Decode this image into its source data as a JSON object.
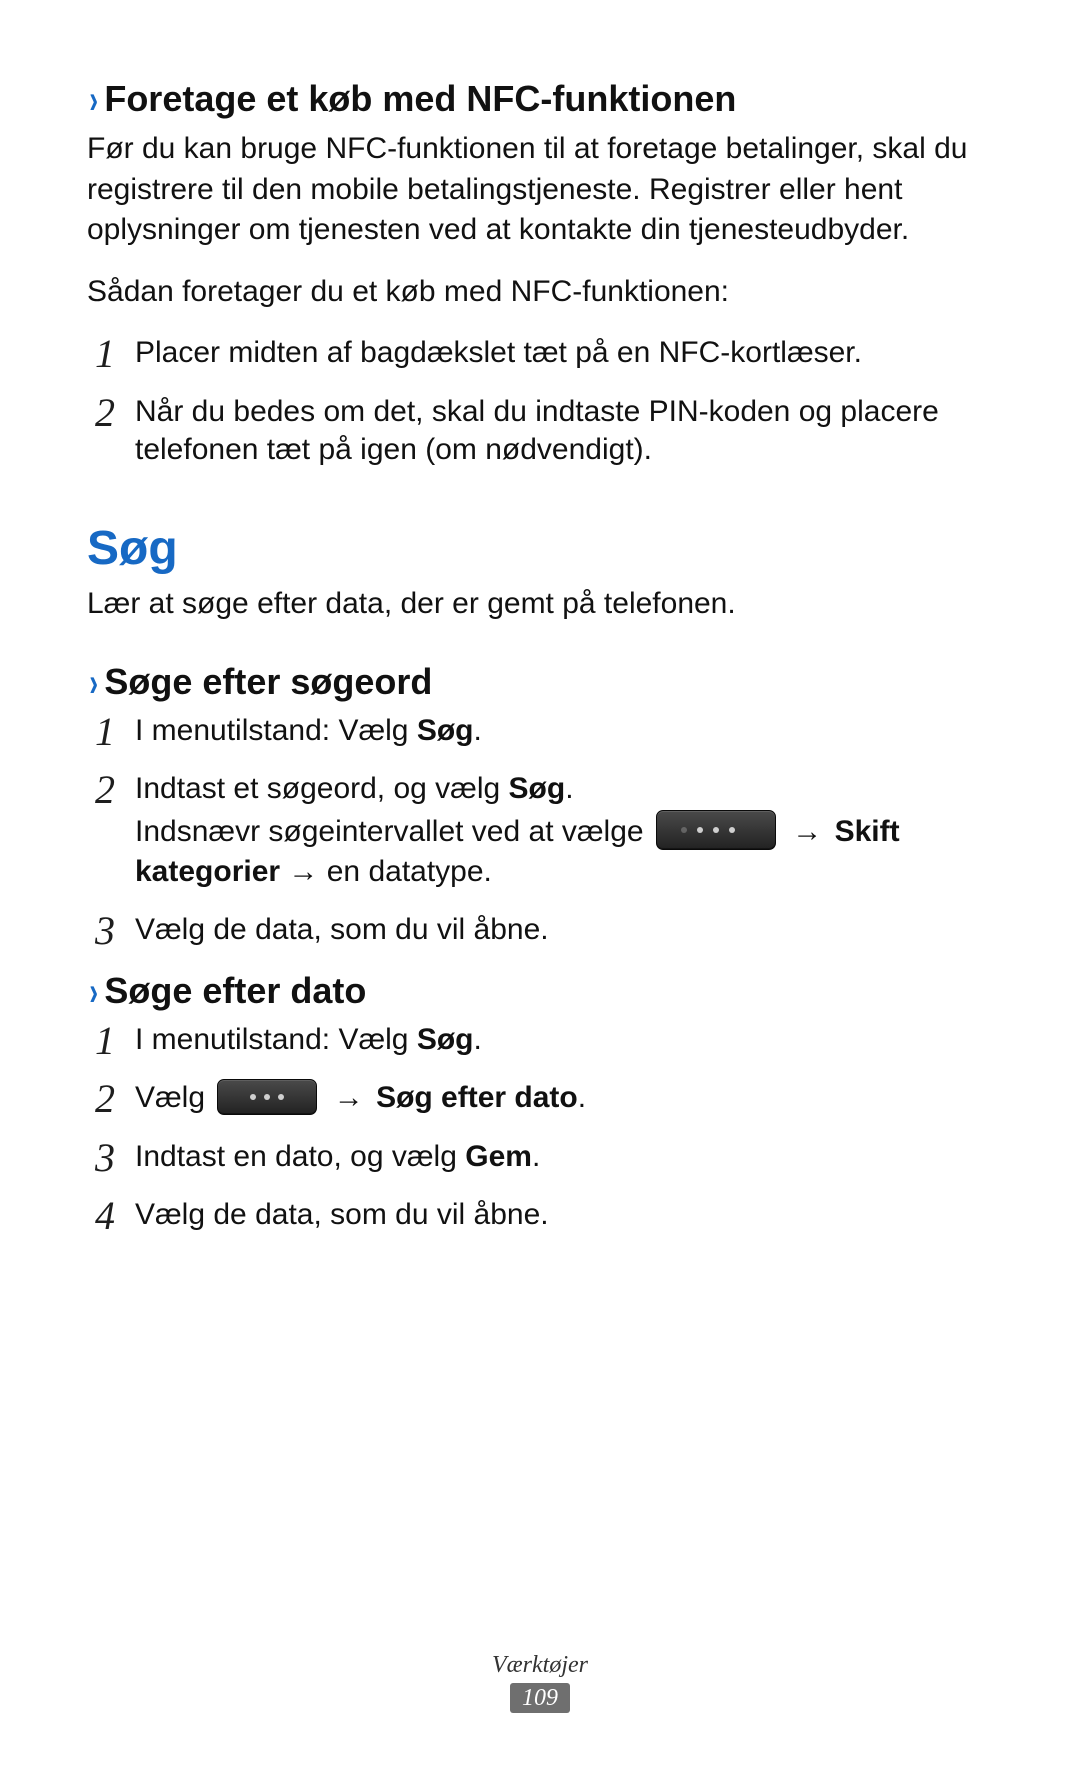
{
  "section1": {
    "heading": "Foretage et køb med NFC-funktionen",
    "intro1": "Før du kan bruge NFC-funktionen til at foretage betalinger, skal du registrere til den mobile betalingstjeneste. Registrer eller hent oplysninger om tjenesten ved at kontakte din tjenesteudbyder.",
    "intro2": "Sådan foretager du et køb med NFC-funktionen:",
    "steps": [
      "Placer midten af bagdækslet tæt på en NFC-kortlæser.",
      "Når du bedes om det, skal du indtaste PIN-koden og placere telefonen tæt på igen (om nødvendigt)."
    ],
    "nums": [
      "1",
      "2"
    ]
  },
  "section2": {
    "title": "Søg",
    "intro": "Lær at søge efter data, der er gemt på telefonen.",
    "sub1": {
      "heading": "Søge efter søgeord",
      "nums": [
        "1",
        "2",
        "3"
      ],
      "step1_a": "I menutilstand: Vælg ",
      "step1_b": "Søg",
      "step1_c": ".",
      "step2_a": "Indtast et søgeord, og vælg ",
      "step2_b": "Søg",
      "step2_c": ".",
      "step2_sub_a": "Indsnævr søgeintervallet ved at vælge ",
      "step2_sub_arrow": "→",
      "step2_sub_b": "Skift kategorier",
      "step2_sub_c": " → en datatype.",
      "step3": "Vælg de data, som du vil åbne."
    },
    "sub2": {
      "heading": "Søge efter dato",
      "nums": [
        "1",
        "2",
        "3",
        "4"
      ],
      "step1_a": "I menutilstand: Vælg ",
      "step1_b": "Søg",
      "step1_c": ".",
      "step2_a": "Vælg ",
      "step2_arrow": "→",
      "step2_b": "Søg efter dato",
      "step2_c": ".",
      "step3_a": "Indtast en dato, og vælg ",
      "step3_b": "Gem",
      "step3_c": ".",
      "step4": "Vælg de data, som du vil åbne."
    }
  },
  "footer": {
    "section": "Værktøjer",
    "page": "109"
  }
}
